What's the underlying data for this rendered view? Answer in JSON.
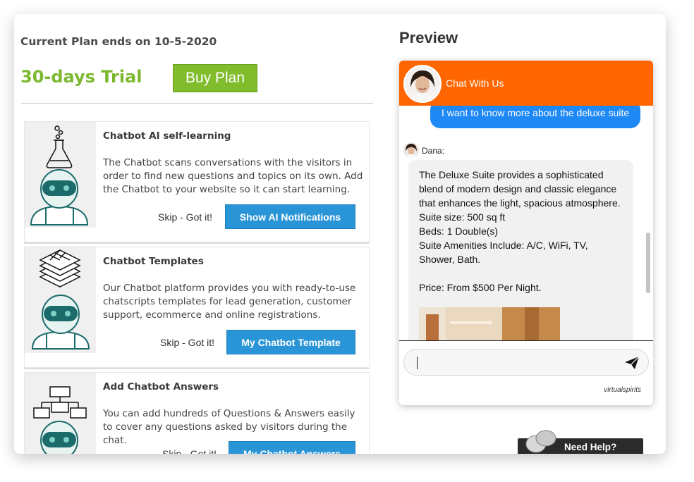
{
  "plan": {
    "ends_text": "Current Plan ends on 10-5-2020",
    "trial_label": "30-days Trial",
    "buy_label": "Buy Plan"
  },
  "cards": [
    {
      "title": "Chatbot AI self-learning",
      "description": "The Chatbot scans conversations with the visitors in order to find new questions and topics on its own. Add the Chatbot to your website so it can start learning.",
      "skip_label": "Skip - Got it!",
      "action_label": "Show AI Notifications",
      "icon": "flask-robot-icon"
    },
    {
      "title": "Chatbot Templates",
      "description": "Our Chatbot platform provides you with ready-to-use chatscripts templates for lead generation, customer support, ecommerce and online registrations.",
      "skip_label": "Skip - Got it!",
      "action_label": "My Chatbot Template",
      "icon": "template-stack-robot-icon"
    },
    {
      "title": "Add Chatbot Answers",
      "description": "You can add hundreds of Questions & Answers easily to cover any questions asked by visitors during the chat.",
      "skip_label": "Skip - Got it!",
      "action_label": "My Chatbot Answers",
      "icon": "flowchart-robot-icon"
    }
  ],
  "preview": {
    "title": "Preview",
    "header_title": "Chat With Us",
    "user_message": "I want to know more about the deluxe suite",
    "agent_name": "Dana:",
    "agent_lines": [
      "The Deluxe Suite provides a sophisticated blend of modern design and classic elegance that enhances the light, spacious atmosphere.",
      "Suite size: 500 sq ft",
      "Beds: 1 Double(s)",
      "Suite Amenities Include: A/C, WiFi, TV, Shower, Bath.",
      "",
      "Price: From $500 Per Night."
    ],
    "input_value": "",
    "brand": "virtualspirits"
  },
  "help": {
    "label": "Need Help?"
  },
  "colors": {
    "trial_green": "#7cb82f",
    "buy_green": "#80bc2c",
    "action_blue": "#2a95d6",
    "chat_header": "#ff6600",
    "user_bubble": "#1e88f5"
  }
}
